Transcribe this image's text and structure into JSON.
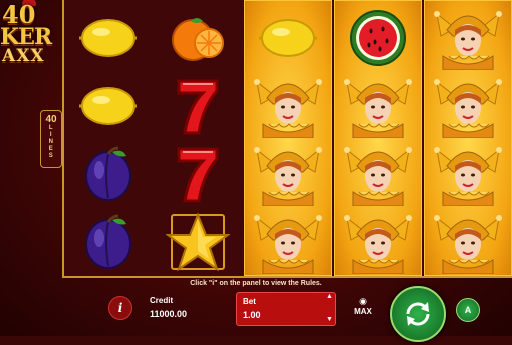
{
  "logo": {
    "line1": "40",
    "line2": "KER",
    "line3": "AXX"
  },
  "lines_badge": {
    "number": "40",
    "word": "LINES"
  },
  "reels": [
    {
      "type": "normal",
      "symbols": [
        "lemon",
        "lemon",
        "plum",
        "plum"
      ]
    },
    {
      "type": "normal",
      "symbols": [
        "orange",
        "seven",
        "seven",
        "star"
      ]
    },
    {
      "type": "gold",
      "symbols": [
        "lemon",
        "joker",
        "joker",
        "joker"
      ]
    },
    {
      "type": "gold",
      "symbols": [
        "watermelon",
        "joker",
        "joker",
        "joker"
      ]
    },
    {
      "type": "gold",
      "symbols": [
        "joker",
        "joker",
        "joker",
        "joker"
      ]
    }
  ],
  "message": "Click \"i\" on the panel to view the Rules.",
  "panel": {
    "info_label": "i",
    "credit_label": "Credit",
    "credit_value": "11000.00",
    "bet_label": "Bet",
    "bet_value": "1.00",
    "max_label": "MAX",
    "auto_label": "A"
  },
  "colors": {
    "accent_gold": "#f3a512",
    "panel_red": "#b80e0e",
    "spin_green": "#1a7a2c"
  }
}
